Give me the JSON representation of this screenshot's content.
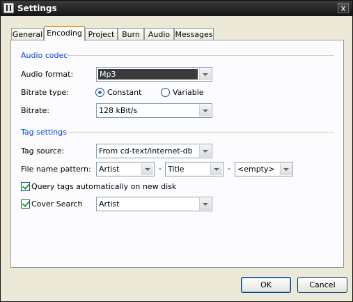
{
  "window": {
    "title": "Settings",
    "close_label": "x"
  },
  "tabs": [
    {
      "label": "General",
      "active": false
    },
    {
      "label": "Encoding",
      "active": true
    },
    {
      "label": "Project",
      "active": false
    },
    {
      "label": "Burn",
      "active": false
    },
    {
      "label": "Audio",
      "active": false
    },
    {
      "label": "Messages",
      "active": false
    }
  ],
  "audio_codec": {
    "title": "Audio codec",
    "format_label": "Audio format:",
    "format_value": "Mp3",
    "bitrate_type_label": "Bitrate type:",
    "constant_label": "Constant",
    "variable_label": "Variable",
    "bitrate_type_selected": "Constant",
    "bitrate_label": "Bitrate:",
    "bitrate_value": "128 kBit/s"
  },
  "tag_settings": {
    "title": "Tag settings",
    "source_label": "Tag source:",
    "source_value": "From cd-text/internet-db",
    "pattern_label": "File name pattern:",
    "pattern_1": "Artist",
    "pattern_2": "Title",
    "pattern_3": "<empty>",
    "separator": "-",
    "query_label": "Query tags automatically on new disk",
    "query_checked": true,
    "cover_label": "Cover Search",
    "cover_checked": true,
    "cover_value": "Artist"
  },
  "buttons": {
    "ok": "OK",
    "cancel": "Cancel"
  },
  "colors": {
    "accent": "#0046d5",
    "tab_highlight": "#e8a427",
    "selection": "#3a3a3a"
  }
}
